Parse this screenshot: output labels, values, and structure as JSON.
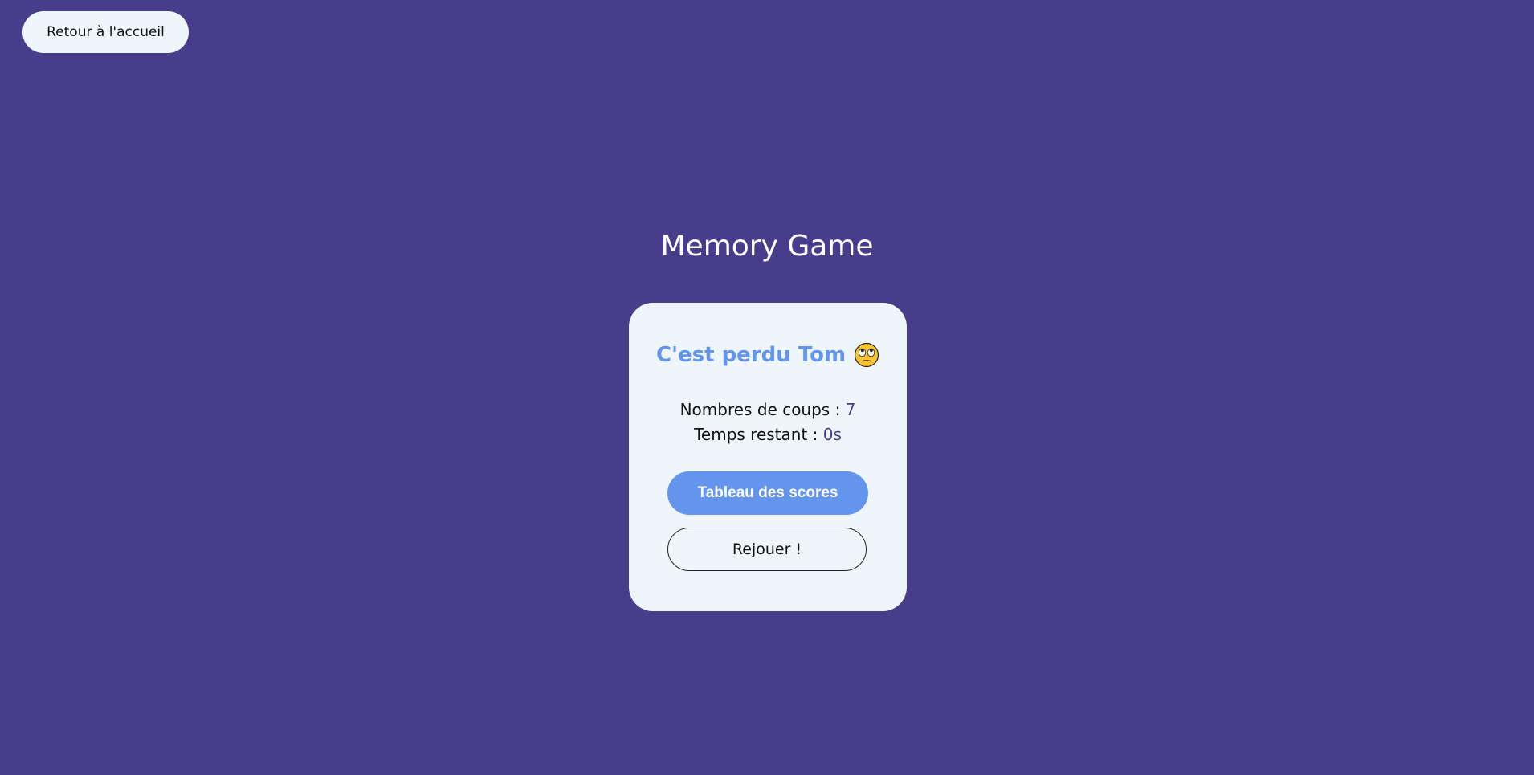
{
  "nav": {
    "home_label": "Retour à l'accueil"
  },
  "game": {
    "title": "Memory Game",
    "result_text": "C'est perdu Tom",
    "result_emoji": "face-with-rolling-eyes-icon",
    "moves_label": "Nombres de coups : ",
    "moves_value": "7",
    "time_label": "Temps restant : ",
    "time_value": "0s"
  },
  "actions": {
    "scores_label": "Tableau des scores",
    "replay_label": "Rejouer !"
  },
  "colors": {
    "background": "#483d8b",
    "card": "#eef6fc",
    "accent": "#6495ed"
  }
}
